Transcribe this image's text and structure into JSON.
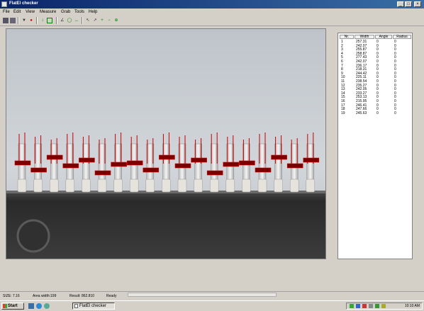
{
  "window": {
    "title": "FlatEl checker"
  },
  "menu": [
    "File",
    "Edit",
    "View",
    "Measure",
    "Grab",
    "Tools",
    "Help"
  ],
  "table": {
    "columns": [
      "Nr.",
      "Width",
      "Angle",
      "Radius"
    ],
    "rows": [
      [
        "1",
        "257.31",
        "0",
        "0"
      ],
      [
        "2",
        "242.07",
        "0",
        "0"
      ],
      [
        "3",
        "255.87",
        "0",
        "0"
      ],
      [
        "4",
        "258.87",
        "0",
        "0"
      ],
      [
        "5",
        "277.43",
        "0",
        "0"
      ],
      [
        "6",
        "242.07",
        "0",
        "0"
      ],
      [
        "7",
        "236.17",
        "0",
        "0"
      ],
      [
        "8",
        "218.31",
        "0",
        "0"
      ],
      [
        "9",
        "244.42",
        "0",
        "0"
      ],
      [
        "10",
        "225.11",
        "0",
        "0"
      ],
      [
        "11",
        "238.54",
        "0",
        "0"
      ],
      [
        "12",
        "235.27",
        "0",
        "0"
      ],
      [
        "13",
        "242.05",
        "0",
        "0"
      ],
      [
        "14",
        "233.27",
        "0",
        "0"
      ],
      [
        "15",
        "253.13",
        "0",
        "0"
      ],
      [
        "16",
        "215.95",
        "0",
        "0"
      ],
      [
        "17",
        "246.41",
        "0",
        "0"
      ],
      [
        "18",
        "247.66",
        "0",
        "0"
      ],
      [
        "19",
        "245.63",
        "0",
        "0"
      ]
    ]
  },
  "status": {
    "size": "SIZE: 7.16",
    "area": "Area width:199",
    "result": "Result: 862.810",
    "state": "Ready"
  },
  "taskbar": {
    "start": "Start",
    "task": "FlatEl checker",
    "clock": "10:10 AM"
  },
  "colors": {
    "titlebar": "#0a246a",
    "marker": "#c00000",
    "background": "#d4d0c8"
  }
}
